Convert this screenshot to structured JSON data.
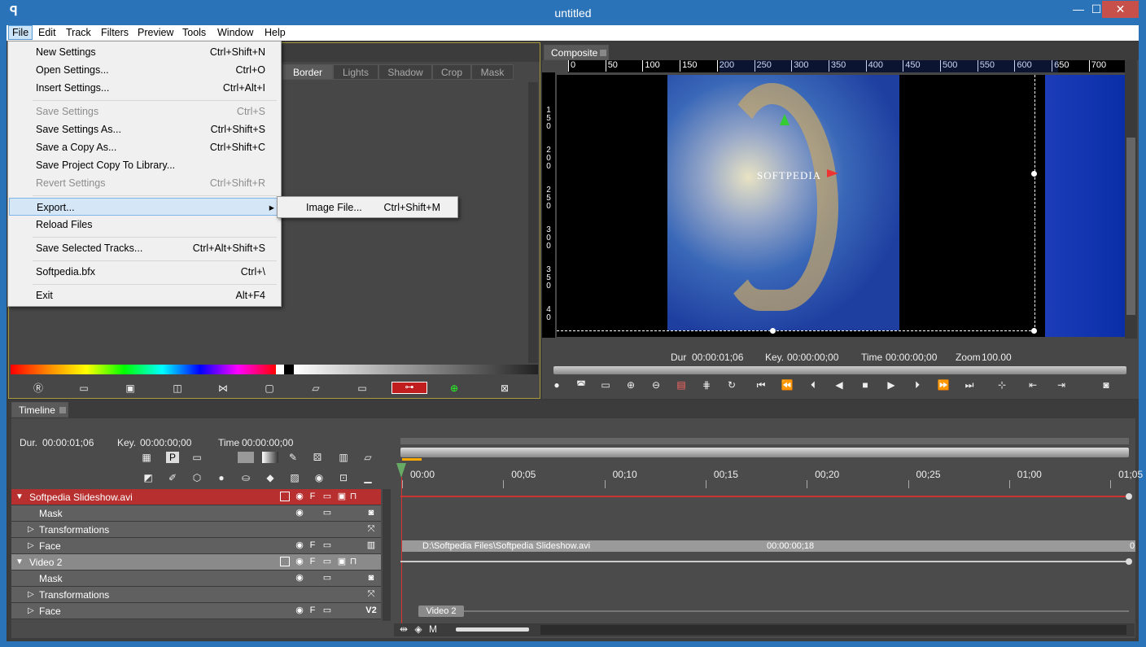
{
  "window": {
    "title": "untitled",
    "minimize": "—",
    "maximize": "☐",
    "close": "✕"
  },
  "menubar": [
    "File",
    "Edit",
    "Track",
    "Filters",
    "Preview",
    "Tools",
    "Window",
    "Help"
  ],
  "file_menu": [
    {
      "label": "New Settings",
      "shortcut": "Ctrl+Shift+N"
    },
    {
      "label": "Open Settings...",
      "shortcut": "Ctrl+O"
    },
    {
      "label": "Insert Settings...",
      "shortcut": "Ctrl+Alt+I"
    },
    {
      "label": "Save Settings",
      "shortcut": "Ctrl+S"
    },
    {
      "label": "Save Settings As...",
      "shortcut": "Ctrl+Shift+S"
    },
    {
      "label": "Save a Copy As...",
      "shortcut": "Ctrl+Shift+C"
    },
    {
      "label": "Save Project Copy To Library...",
      "shortcut": ""
    },
    {
      "label": "Revert Settings",
      "shortcut": "Ctrl+Shift+R"
    },
    {
      "label": "Export...",
      "shortcut": ""
    },
    {
      "label": "Reload Files",
      "shortcut": ""
    },
    {
      "label": "Save Selected Tracks...",
      "shortcut": "Ctrl+Alt+Shift+S"
    },
    {
      "label": "Softpedia.bfx",
      "shortcut": "Ctrl+\\"
    },
    {
      "label": "Exit",
      "shortcut": "Alt+F4"
    }
  ],
  "export_submenu": {
    "label": "Image File...",
    "shortcut": "Ctrl+Shift+M"
  },
  "settings_tabs": [
    "Border",
    "Lights",
    "Shadow",
    "Crop",
    "Mask"
  ],
  "composite": {
    "tab": "Composite",
    "ruler_x": [
      "0",
      "50",
      "100",
      "150",
      "200",
      "250",
      "300",
      "350",
      "400",
      "450",
      "500",
      "550",
      "600",
      "650",
      "700"
    ],
    "ruler_y": [
      "150",
      "200",
      "250",
      "300",
      "350",
      "40"
    ],
    "watermark": "SOFTPEDIA",
    "dur_label": "Dur",
    "dur": "00:00:01;06",
    "key_label": "Key.",
    "key": "00:00:00;00",
    "time_label": "Time",
    "time": "00:00:00;00",
    "zoom_label": "Zoom",
    "zoom": "100.00"
  },
  "timeline": {
    "tab": "Timeline",
    "dur_label": "Dur.",
    "dur": "00:00:01;06",
    "key_label": "Key.",
    "key": "00:00:00;00",
    "time_label": "Time",
    "time": "00:00:00;00",
    "ticks": [
      "00:00",
      "00;05",
      "00;10",
      "00;15",
      "00;20",
      "00;25",
      "01;00",
      "01;05"
    ],
    "tracks": [
      {
        "name": "Softpedia Slideshow.avi",
        "type": "header"
      },
      {
        "name": "Mask",
        "type": "sub"
      },
      {
        "name": "Transformations",
        "type": "sub"
      },
      {
        "name": "Face",
        "type": "sub"
      },
      {
        "name": "Video 2",
        "type": "header2"
      },
      {
        "name": "Mask",
        "type": "sub"
      },
      {
        "name": "Transformations",
        "type": "sub"
      },
      {
        "name": "Face",
        "type": "sub"
      }
    ],
    "clip_path": "D:\\Softpedia Files\\Softpedia Slideshow.avi",
    "clip_dur": "00:00:00;18",
    "clip_end": "0",
    "clip2": "Video 2",
    "v2_badge": "V2"
  },
  "colors": {
    "accent": "#2b73b9",
    "track_selected": "#b72f2f",
    "playhead": "#d33"
  }
}
